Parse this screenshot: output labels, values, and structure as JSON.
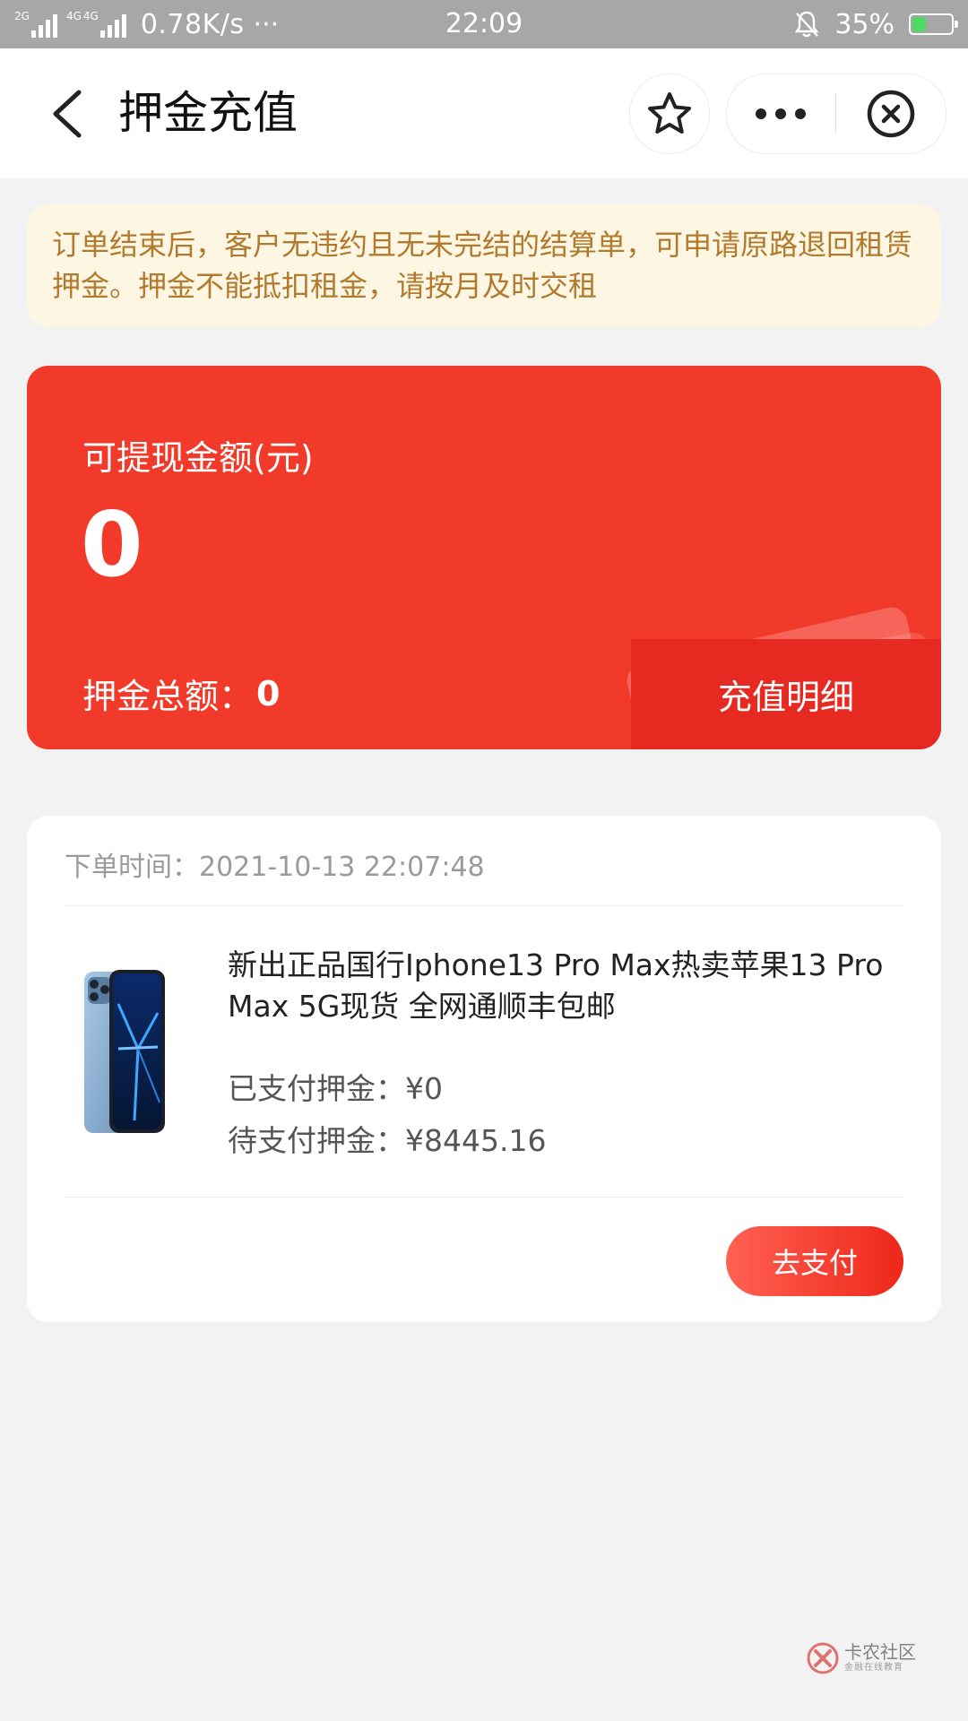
{
  "status_bar": {
    "net1": "2G",
    "net2": "4G",
    "net3": "4G",
    "speed": "0.78K/s",
    "more": "···",
    "time": "22:09",
    "battery": "35%",
    "battery_level": 0.35
  },
  "nav": {
    "title": "押金充值",
    "back_icon": "chevron-left-icon",
    "favorite_icon": "star-icon",
    "more_icon": "more-dots-icon",
    "close_icon": "close-circle-icon"
  },
  "notice": {
    "text": "订单结束后，客户无违约且无未完结的结算单，可申请原路退回租赁押金。押金不能抵扣租金，请按月及时交租"
  },
  "balance": {
    "label": "可提现金额(元)",
    "amount": "0",
    "total_label": "押金总额：",
    "total_value": "0",
    "detail_button": "充值明细"
  },
  "order": {
    "time_label": "下单时间：",
    "time_value": "2021-10-13 22:07:48",
    "product_name": "新出正品国行Iphone13 Pro Max热卖苹果13 Pro Max 5G现货 全网通顺丰包邮",
    "paid_label": "已支付押金：",
    "paid_value": "¥0",
    "due_label": "待支付押金：",
    "due_value": "¥8445.16",
    "pay_button": "去支付"
  },
  "watermark": {
    "main": "卡农社区",
    "sub": "金融在线教育"
  },
  "colors": {
    "primary_red": "#f23a2b",
    "notice_bg": "#fdf6e2",
    "notice_text": "#b27a2e",
    "page_bg": "#f2f2f2"
  }
}
